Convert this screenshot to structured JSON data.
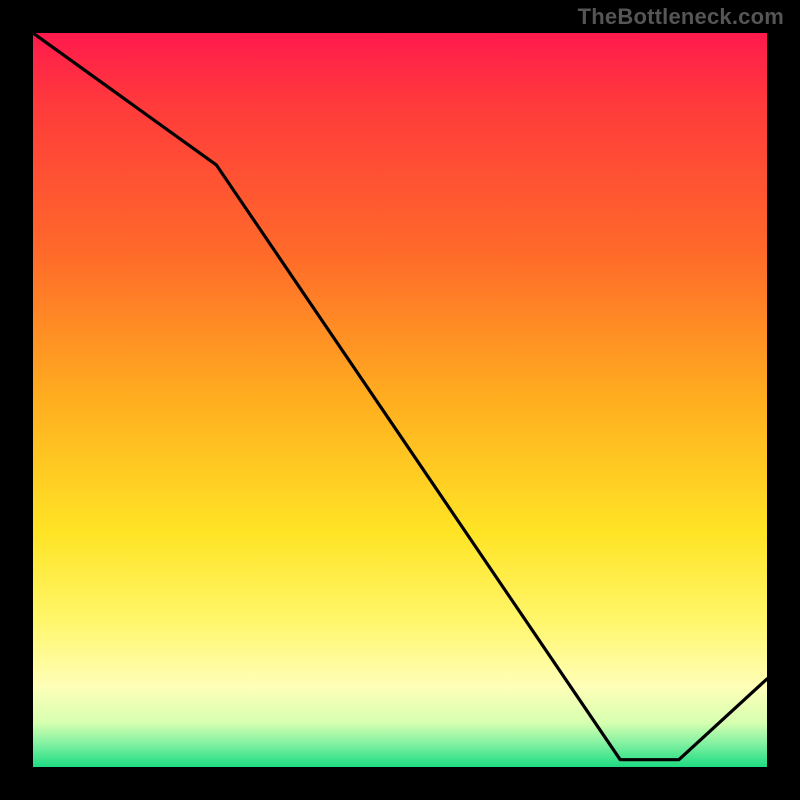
{
  "watermark": "TheBottleneck.com",
  "annotation": {
    "label": ""
  },
  "chart_data": {
    "type": "line",
    "title": "",
    "xlabel": "",
    "ylabel": "",
    "xlim": [
      0,
      100
    ],
    "ylim": [
      0,
      100
    ],
    "x": [
      0,
      25,
      80,
      88,
      100
    ],
    "values": [
      100,
      82,
      1,
      1,
      12
    ],
    "gradient_stops": [
      {
        "pos": 0.0,
        "color": "#ff1a4d"
      },
      {
        "pos": 0.1,
        "color": "#ff3b3b"
      },
      {
        "pos": 0.3,
        "color": "#ff6a2a"
      },
      {
        "pos": 0.5,
        "color": "#ffae1f"
      },
      {
        "pos": 0.68,
        "color": "#ffe425"
      },
      {
        "pos": 0.8,
        "color": "#fff66a"
      },
      {
        "pos": 0.89,
        "color": "#ffffb8"
      },
      {
        "pos": 0.94,
        "color": "#d6ffb0"
      },
      {
        "pos": 0.97,
        "color": "#7cf0a0"
      },
      {
        "pos": 1.0,
        "color": "#1ddb81"
      }
    ]
  }
}
